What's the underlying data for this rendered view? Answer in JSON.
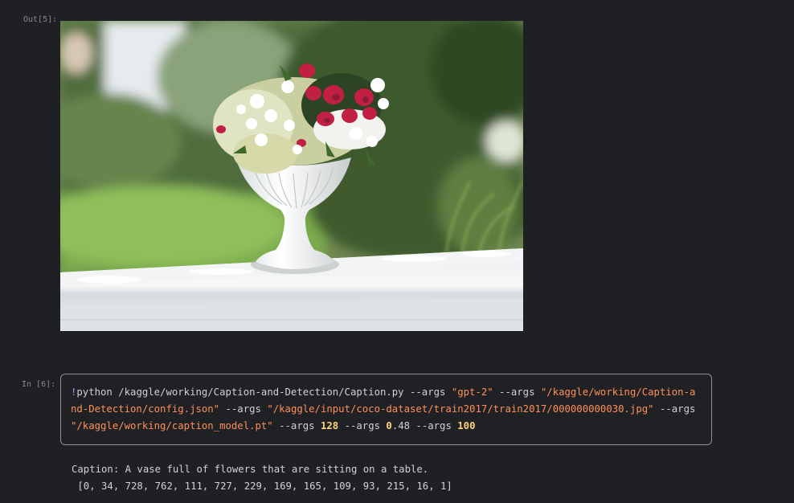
{
  "cells": {
    "out_prompt": "Out[5]:",
    "in_prompt": "In [6]:"
  },
  "image_output": {
    "alt": "A white vase full of flowers sitting on a white railing"
  },
  "code": {
    "bang": "!",
    "cmd": "python /kaggle/working/Caption-and-Detection/Caption.py --args ",
    "arg1": "\"gpt-2\"",
    "sep1": " --args ",
    "arg2": "\"/kaggle/working/Caption-and-Detection/config.json\"",
    "sep2": " --args ",
    "arg3": "\"/kaggle/input/coco-dataset/train2017/train2017/000000000030.jpg\"",
    "sep3": " --args ",
    "arg4": "\"/kaggle/working/caption_model.pt\"",
    "sep4": " --args ",
    "num1": "128",
    "sep5": " --args ",
    "num2a": "0",
    "num2b": ".48",
    "sep6": " --args ",
    "num3": "100"
  },
  "output": {
    "caption_line": "Caption: A vase full of flowers that are sitting on a table.",
    "tokens_line": " [0, 34, 728, 762, 111, 727, 229, 169, 165, 109, 93, 215, 16, 1]"
  }
}
